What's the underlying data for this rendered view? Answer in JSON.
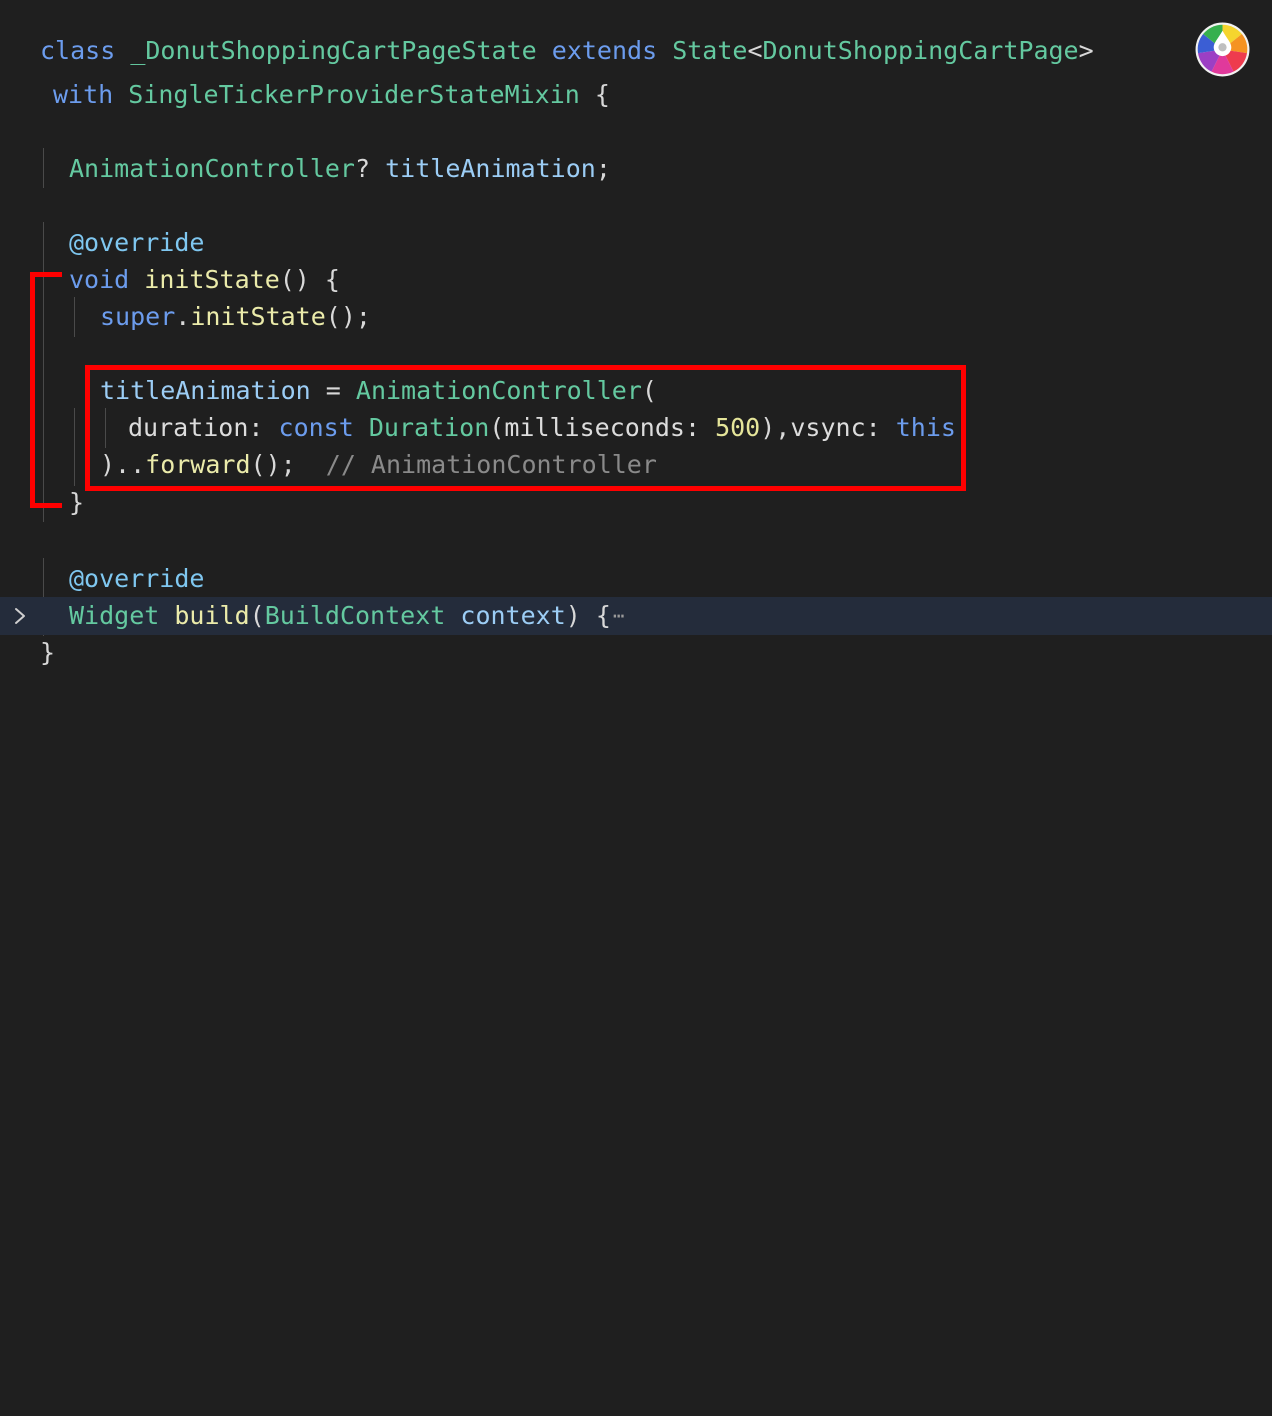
{
  "editor": {
    "background_color": "#1f1f1f",
    "highlight_row_color": "#242c3b",
    "annotation_color": "#ff0000",
    "gutter_fold_chevron": "❯"
  },
  "code": {
    "line1": {
      "kw_class": "class",
      "class_name": "_DonutShoppingCartPageState",
      "kw_extends": "extends",
      "base_type": "State",
      "lt": "<",
      "generic_arg": "DonutShoppingCartPage",
      "gt": ">"
    },
    "line2": {
      "kw_with": "with",
      "mixin": "SingleTickerProviderStateMixin",
      "brace": "{"
    },
    "line4": {
      "type": "AnimationController",
      "nullable": "?",
      "field": "titleAnimation",
      "semi": ";"
    },
    "line6": {
      "annotation": "@override"
    },
    "line7": {
      "kw_void": "void",
      "method": "initState",
      "parens": "()",
      "brace": "{"
    },
    "line8": {
      "super": "super",
      "dot": ".",
      "method": "initState",
      "tail": "();"
    },
    "line10": {
      "field": "titleAnimation",
      "equals": "=",
      "ctor": "AnimationController",
      "open_paren": "("
    },
    "line11": {
      "param_duration": "duration:",
      "kw_const": "const",
      "type_duration": "Duration",
      "open_paren": "(",
      "param_ms": "milliseconds:",
      "value_ms": "500",
      "close_paren": ")",
      "comma": ",",
      "param_vsync": "vsync:",
      "kw_this": "this"
    },
    "line12": {
      "close_cascade": ")..",
      "method_forward": "forward",
      "tail": "();",
      "comment": "// AnimationController"
    },
    "line13": {
      "brace": "}"
    },
    "line15": {
      "annotation": "@override"
    },
    "line16": {
      "return_type": "Widget",
      "method": "build",
      "open_paren": "(",
      "param_type": "BuildContext",
      "param_name": "context",
      "close_paren": ")",
      "brace": "{",
      "folded_ellipsis": "⋯"
    },
    "line17": {
      "brace": "}"
    }
  },
  "logo": {
    "name": "donut-color-wheel-logo",
    "segments": [
      {
        "name": "yellow",
        "color": "#f5d52e"
      },
      {
        "name": "orange",
        "color": "#f59322"
      },
      {
        "name": "red",
        "color": "#ee3b4e"
      },
      {
        "name": "magenta",
        "color": "#e0399b"
      },
      {
        "name": "purple",
        "color": "#9c3fc4"
      },
      {
        "name": "blue",
        "color": "#3b5ed4"
      },
      {
        "name": "green",
        "color": "#36b04e"
      }
    ],
    "hole_color": "#ffffff",
    "center_dot_color": "#bfbfbf"
  }
}
